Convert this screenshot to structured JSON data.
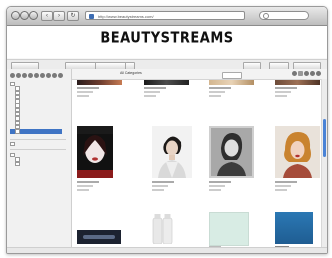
{
  "browser": {
    "url": "http://www.beautystreams.com/",
    "search_placeholder": ""
  },
  "site": {
    "logo_text": "BEAUTYSTREAMS"
  },
  "section": {
    "title": "All Categories"
  },
  "colors": {
    "selection": "#3f74c4",
    "scroll_thumb": "#4a83d6",
    "photo_cover": "#b03030"
  }
}
